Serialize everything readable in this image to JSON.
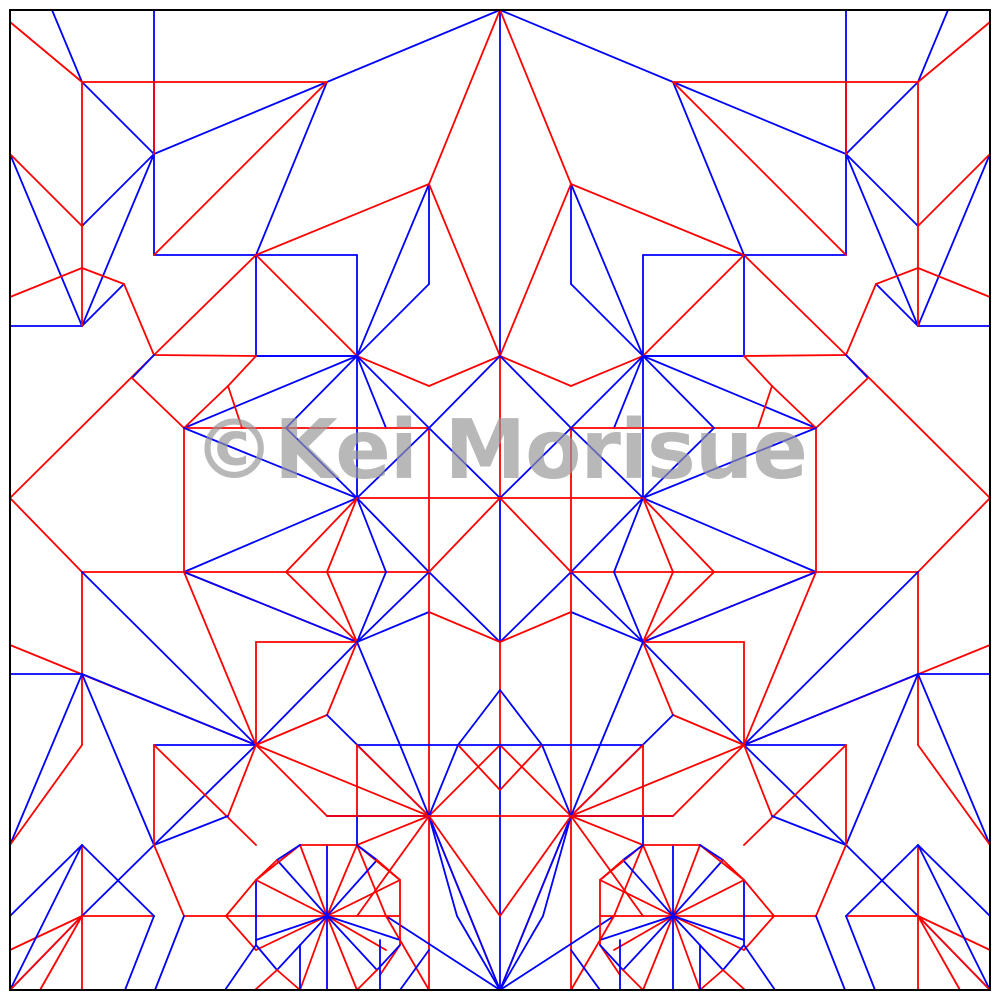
{
  "diagram": {
    "kind": "origami crease pattern",
    "watermark": "©Kei Morisue",
    "colors": {
      "mountain": "#ff0000",
      "valley": "#0000ff",
      "border": "#000000",
      "watermark": "#969696",
      "background": "#ffffff"
    },
    "line_types": [
      "mountain",
      "valley"
    ]
  }
}
